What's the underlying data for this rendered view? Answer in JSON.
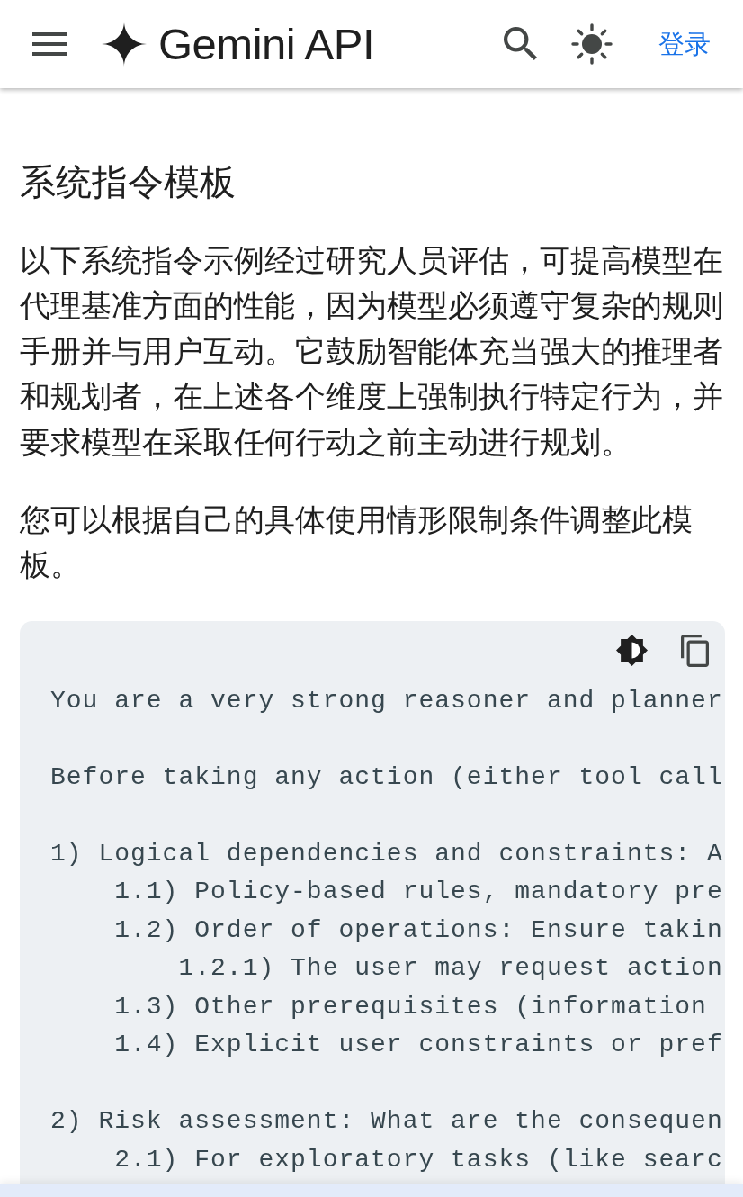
{
  "header": {
    "title": "Gemini API",
    "login": "登录"
  },
  "heading": "系统指令模板",
  "paragraphs": [
    "以下系统指令示例经过研究人员评估，可提高模型在代理基准方面的性能，因为模型必须遵守复杂的规则手册并与用户互动。它鼓励智能体充当强大的推理者和规划者，在上述各个维度上强制执行特定行为，并要求模型在采取任何行动之前主动进行规划。",
    "您可以根据自己的具体使用情形限制条件调整此模板。"
  ],
  "code_block": {
    "text": "You are a very strong reasoner and planner\n\nBefore taking any action (either tool call\n\n1) Logical dependencies and constraints: A\n    1.1) Policy-based rules, mandatory pre\n    1.2) Order of operations: Ensure takin\n        1.2.1) The user may request action\n    1.3) Other prerequisites (information\n    1.4) Explicit user constraints or pref\n\n2) Risk assessment: What are the consequen\n    2.1) For exploratory tasks (like searc"
  }
}
